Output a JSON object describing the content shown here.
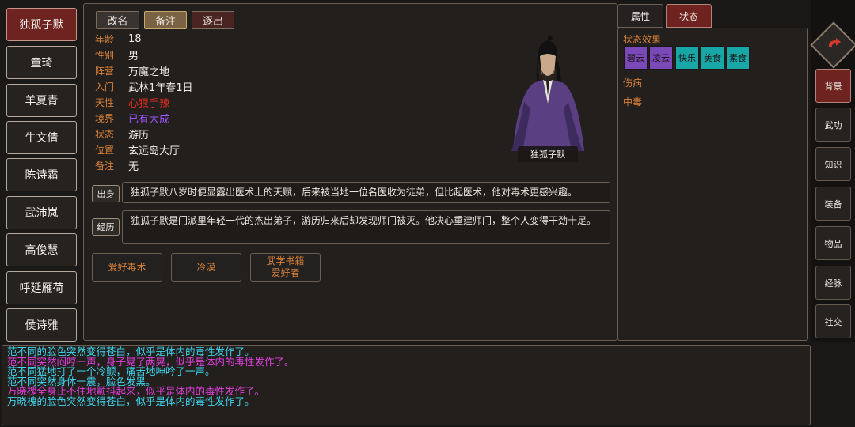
{
  "roster": [
    {
      "name": "独孤子默",
      "active": true
    },
    {
      "name": "童琦"
    },
    {
      "name": "羊夏青"
    },
    {
      "name": "牛文倩"
    },
    {
      "name": "陈诗霜"
    },
    {
      "name": "武沛岚"
    },
    {
      "name": "高俊慧"
    },
    {
      "name": "呼延雁荷"
    },
    {
      "name": "侯诗雅"
    }
  ],
  "actions": {
    "rename": "改名",
    "note": "备注",
    "expel": "逐出"
  },
  "info": [
    {
      "label": "年龄",
      "value": "18"
    },
    {
      "label": "性别",
      "value": "男"
    },
    {
      "label": "阵营",
      "value": "万魔之地"
    },
    {
      "label": "入门",
      "value": "武林1年春1日"
    },
    {
      "label": "天性",
      "value": "心狠手辣",
      "color": "#e02b20"
    },
    {
      "label": "境界",
      "value": "已有大成",
      "color": "#9f55ff"
    },
    {
      "label": "状态",
      "value": "游历"
    },
    {
      "label": "位置",
      "value": "玄远岛大厅"
    },
    {
      "label": "备注",
      "value": "无"
    }
  ],
  "portrait": {
    "name": "独孤子默"
  },
  "origin": {
    "tag": "出身",
    "text": "独孤子默八岁时便显露出医术上的天赋，后来被当地一位名医收为徒弟，但比起医术，他对毒术更感兴趣。"
  },
  "history": {
    "tag": "经历",
    "text": "独孤子默是门派里年轻一代的杰出弟子，游历归来后却发现师门被灭。他决心重建师门，整个人变得干劲十足。"
  },
  "traits": [
    "爱好毒术",
    "冷漠",
    "武学书籍\n爱好者"
  ],
  "status_panel": {
    "tabs": {
      "attributes": "属性",
      "status": "状态"
    },
    "effects_title": "状态效果",
    "effects": [
      {
        "label": "碧云",
        "color": "#7b48b8"
      },
      {
        "label": "凌云",
        "color": "#7b48b8"
      },
      {
        "label": "快乐",
        "color": "#18a6a6"
      },
      {
        "label": "美食",
        "color": "#18a6a6"
      },
      {
        "label": "素食",
        "color": "#18a6a6"
      }
    ],
    "injury_title": "伤病",
    "poison_title": "中毒"
  },
  "menu": [
    {
      "label": "背景",
      "active": true
    },
    {
      "label": "武功"
    },
    {
      "label": "知识"
    },
    {
      "label": "装备"
    },
    {
      "label": "物品"
    },
    {
      "label": "经脉"
    },
    {
      "label": "社交"
    }
  ],
  "log": [
    {
      "text": "范不同的脸色突然变得苍白，似乎是体内的毒性发作了。",
      "color": "#3fd6ef"
    },
    {
      "text": "范不同突然闷哼一声，身子晃了两晃，似乎是体内的毒性发作了。",
      "color": "#e43fe0"
    },
    {
      "text": "范不同猛地打了一个冷颤，痛苦地呻吟了一声。",
      "color": "#3fd6ef"
    },
    {
      "text": "范不同突然身体一震，脸色发黑。",
      "color": "#3fd6ef"
    },
    {
      "text": "万晓槐全身止不住地颤抖起来，似乎是体内的毒性发作了。",
      "color": "#e43fe0"
    },
    {
      "text": "万晓槐的脸色突然变得苍白，似乎是体内的毒性发作了。",
      "color": "#3fd6ef"
    }
  ]
}
